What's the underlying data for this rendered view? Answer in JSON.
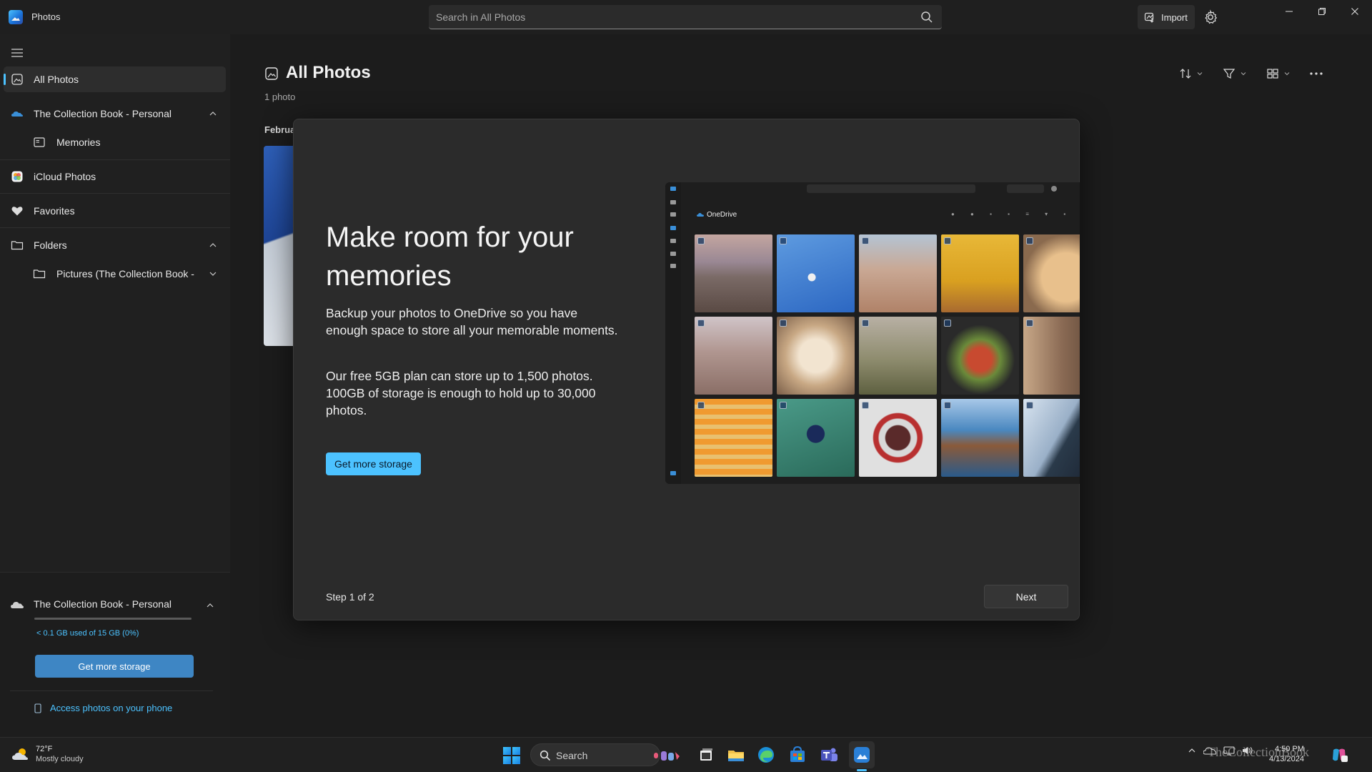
{
  "window": {
    "app_title": "Photos",
    "import_label": "Import"
  },
  "search": {
    "placeholder": "Search in All Photos"
  },
  "sidebar": {
    "items": [
      {
        "label": "All Photos"
      },
      {
        "label": "The Collection Book - Personal"
      },
      {
        "label": "Memories"
      },
      {
        "label": "iCloud Photos"
      },
      {
        "label": "Favorites"
      },
      {
        "label": "Folders"
      },
      {
        "label": "Pictures (The Collection Book -"
      }
    ],
    "storage": {
      "account": "The Collection Book - Personal",
      "usage_text": "< 0.1 GB used of 15 GB (0%)",
      "usage_fraction": 0.0,
      "button_label": "Get more storage",
      "phone_link": "Access photos on your phone"
    }
  },
  "main": {
    "title": "All Photos",
    "count": "1 photo",
    "date_header": "Februa"
  },
  "dialog": {
    "title": "Make room for your memories",
    "paragraph1": "Backup your photos to OneDrive so you have enough space to store all your memorable moments.",
    "paragraph2": "Our free 5GB plan can store up to 1,500 photos. 100GB of storage is enough to hold up to 30,000 photos.",
    "cta_label": "Get more storage",
    "step": "Step 1 of 2",
    "next_label": "Next",
    "preview": {
      "title": "OneDrive"
    }
  },
  "taskbar": {
    "weather_temp": "72°F",
    "weather_desc": "Mostly cloudy",
    "search_label": "Search",
    "time": "4:50 PM",
    "date": "4/13/2024",
    "watermark": "TheCollectionBook"
  },
  "colors": {
    "accent": "#4cc2ff",
    "dialog_bg": "#2b2b2b",
    "app_bg": "#1c1c1c"
  }
}
